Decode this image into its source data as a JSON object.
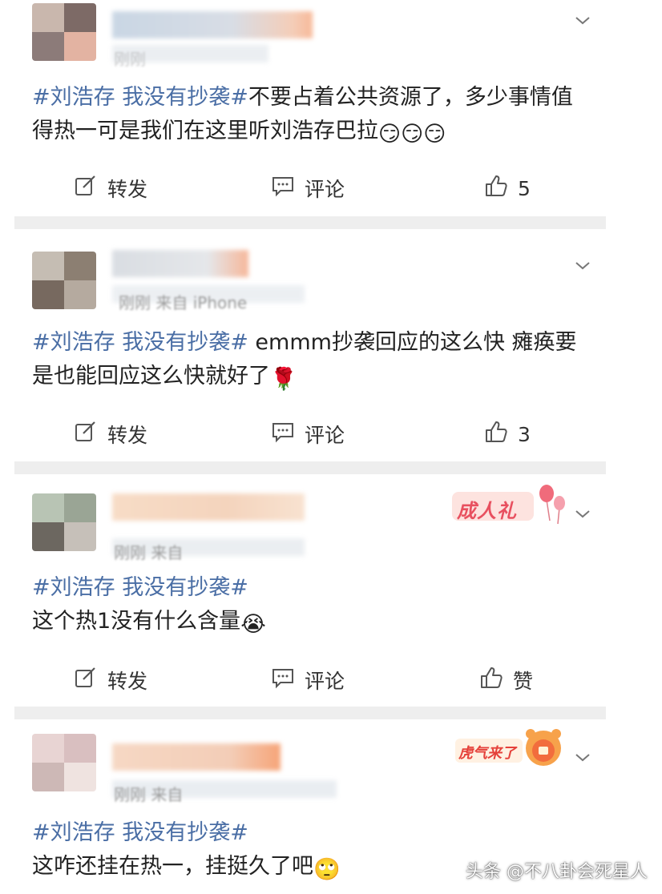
{
  "posts": [
    {
      "meta": "刚刚",
      "topic": "#刘浩存 我没有抄袭#",
      "text": "不要占着公共资源了，多少事情值得热一可是我们在这里听刘浩存巴拉",
      "emoji": "😏😏😏",
      "repost_label": "转发",
      "comment_label": "评论",
      "like_count": "5"
    },
    {
      "meta": "刚刚 来自 iPhone",
      "topic": "#刘浩存 我没有抄袭#",
      "text": " emmm抄袭回应的这么快 瘫痪要是也能回应这么快就好了",
      "emoji": "🌹",
      "repost_label": "转发",
      "comment_label": "评论",
      "like_count": "3"
    },
    {
      "meta": "刚刚 来自",
      "topic": "#刘浩存 我没有抄袭#",
      "text": "这个热1没有什么含量",
      "emoji": "😭",
      "repost_label": "转发",
      "comment_label": "评论",
      "like_count": "赞",
      "badge": "成人礼"
    },
    {
      "meta": "刚刚 来自",
      "topic": "#刘浩存 我没有抄袭#",
      "text": "这咋还挂在热一，挂挺久了吧",
      "emoji": "🙄",
      "badge": "虎气来了"
    }
  ],
  "watermark": "头条 @不八卦会死星人",
  "colors": {
    "topic": "#4a6ea5",
    "divider": "#eeeeee",
    "text": "#222222",
    "icon": "#555555"
  },
  "icons": [
    "edit-icon",
    "comment-icon",
    "thumbs-up-icon",
    "chevron-down-icon"
  ]
}
